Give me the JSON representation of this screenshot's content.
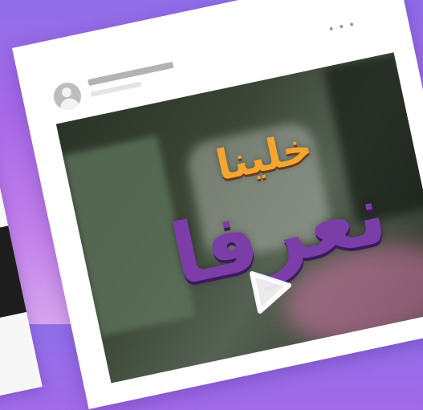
{
  "post": {
    "more_icon": "more-horizontal-icon",
    "avatar_icon": "user-avatar-icon",
    "video": {
      "title_line1": "خلينا",
      "title_line2": "نعرفا",
      "play_icon": "play-icon"
    }
  },
  "colors": {
    "background_top": "#8f6ee8",
    "background_bottom": "#d6a4ee",
    "card": "#ffffff",
    "title_orange": "#f4a62f",
    "title_purple": "#7b3ea8"
  }
}
